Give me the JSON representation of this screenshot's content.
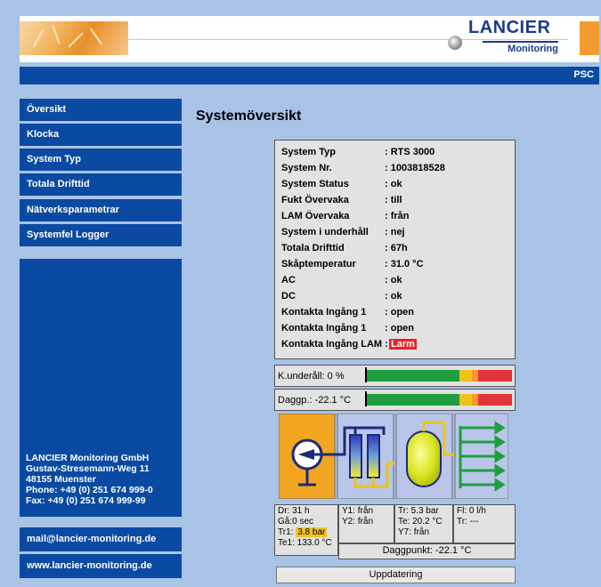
{
  "header": {
    "logo_name": "LANCIER",
    "logo_sub": "Monitoring",
    "bar_label": "PSC"
  },
  "sidebar": {
    "items": [
      {
        "label": "Översikt"
      },
      {
        "label": "Klocka"
      },
      {
        "label": "System Typ"
      },
      {
        "label": "Totala Drifttid"
      },
      {
        "label": "Nätverksparametrar"
      },
      {
        "label": "Systemfel Logger"
      }
    ],
    "company": [
      "LANCIER Monitoring GmbH",
      "Gustav-Stresemann-Weg 11",
      "48155 Muenster",
      "Phone: +49 (0) 251 674 999-0",
      "Fax: +49 (0) 251 674 999-99"
    ],
    "email": "mail@lancier-monitoring.de",
    "website": "www.lancier-monitoring.de"
  },
  "main": {
    "title": "Systemöversikt",
    "status": [
      {
        "label": "System Typ",
        "value": ": RTS 3000"
      },
      {
        "label": "System Nr.",
        "value": ": 1003818528"
      },
      {
        "label": "System Status",
        "value": ": ok"
      },
      {
        "label": "Fukt Övervaka",
        "value": ": till"
      },
      {
        "label": "LAM Övervaka",
        "value": ": från"
      },
      {
        "label": "System i underhåll",
        "value": ": nej"
      },
      {
        "label": "Totala Drifttid",
        "value": ": 67h"
      },
      {
        "label": "Skåptemperatur",
        "value": ": 31.0 °C"
      },
      {
        "label": "AC",
        "value": ": ok"
      },
      {
        "label": "DC",
        "value": ": ok"
      },
      {
        "label": "Kontakta Ingång 1",
        "value": ": open"
      },
      {
        "label": "Kontakta Ingång 1",
        "value": ": open"
      },
      {
        "label": "Kontakta Ingång LAM :",
        "value": "Larm"
      }
    ],
    "bars": [
      {
        "label": "K.underåll: 0 %",
        "fraction": 0.0
      },
      {
        "label": "Daggp.: -22.1 °C",
        "fraction": 0.0
      }
    ],
    "readouts": {
      "dr": "Dr: 31 h",
      "ga": "Gå:0 sec",
      "tr1_label": "Tr1:",
      "tr1_value": "3.8 bar",
      "te1": "Te1: 133.0 °C",
      "y1": "Y1: från",
      "y2": "Y2: från",
      "tr": "Tr: 5.3 bar",
      "te": "Te: 20.2 °C",
      "y7": "Y7: från",
      "fl": "Fl: 0 l/h",
      "tr2": "Tr: ---",
      "dewpoint": "Daggpunkt: -22.1 °C"
    },
    "refresh_label": "Uppdatering"
  },
  "colors": {
    "background": "#a9c3e6",
    "nav_blue": "#0b4aa2",
    "accent_orange": "#f49a2e",
    "alarm_red": "#e5232a",
    "highlight_yellow": "#f2c22c"
  }
}
